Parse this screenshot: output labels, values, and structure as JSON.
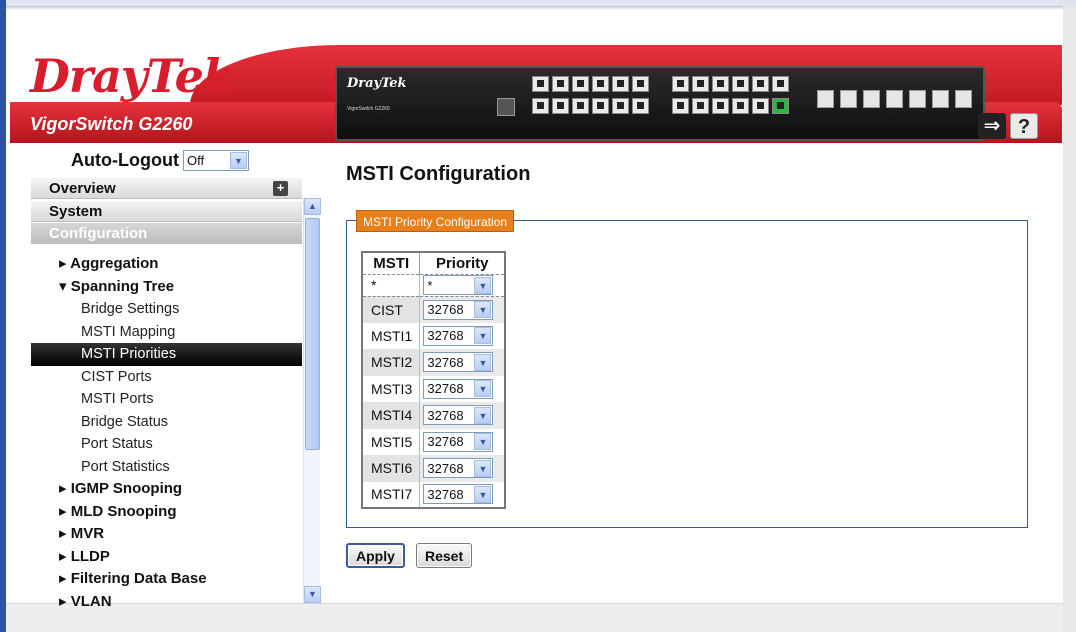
{
  "header": {
    "brand": "DrayTek",
    "model": "VigorSwitch G2260",
    "panel_brand": "DrayTek",
    "panel_model": "VigorSwitch G2260",
    "logout_icon": "logout-arrow-icon",
    "help_label": "?"
  },
  "sidebar": {
    "auto_logout_label": "Auto-Logout",
    "auto_logout_value": "Off",
    "sections": {
      "overview": "Overview",
      "system": "System",
      "configuration": "Configuration"
    },
    "items": [
      {
        "label": "▸ Aggregation"
      },
      {
        "label": "▾ Spanning Tree"
      },
      {
        "label": "Bridge Settings"
      },
      {
        "label": "MSTI Mapping"
      },
      {
        "label": "MSTI Priorities"
      },
      {
        "label": "CIST Ports"
      },
      {
        "label": "MSTI Ports"
      },
      {
        "label": "Bridge Status"
      },
      {
        "label": "Port Status"
      },
      {
        "label": "Port Statistics"
      },
      {
        "label": "▸ IGMP Snooping"
      },
      {
        "label": "▸ MLD Snooping"
      },
      {
        "label": "▸ MVR"
      },
      {
        "label": "▸ LLDP"
      },
      {
        "label": "▸ Filtering Data Base"
      },
      {
        "label": "▸ VLAN"
      }
    ]
  },
  "main": {
    "title": "MSTI Configuration",
    "legend": "MSTI Priority Configuration",
    "columns": [
      "MSTI",
      "Priority"
    ],
    "star_row": {
      "name": "*",
      "priority": "*"
    },
    "rows": [
      {
        "name": "CIST",
        "priority": "32768"
      },
      {
        "name": "MSTI1",
        "priority": "32768"
      },
      {
        "name": "MSTI2",
        "priority": "32768"
      },
      {
        "name": "MSTI3",
        "priority": "32768"
      },
      {
        "name": "MSTI4",
        "priority": "32768"
      },
      {
        "name": "MSTI5",
        "priority": "32768"
      },
      {
        "name": "MSTI6",
        "priority": "32768"
      },
      {
        "name": "MSTI7",
        "priority": "32768"
      }
    ],
    "apply_label": "Apply",
    "reset_label": "Reset"
  },
  "colors": {
    "brand_red": "#d81e2c",
    "legend_orange": "#e77f1a",
    "selected_bg": "#000000"
  }
}
